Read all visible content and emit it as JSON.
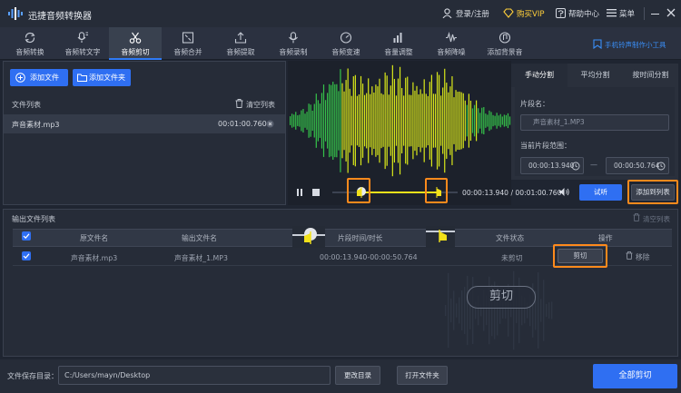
{
  "app": {
    "title": "迅捷音频转换器",
    "login": "登录/注册",
    "vip": "购买VIP",
    "help": "帮助中心",
    "menu": "菜单"
  },
  "nav": {
    "tabs": [
      {
        "label": "音频转换",
        "icon": "refresh-icon"
      },
      {
        "label": "音频转文字",
        "icon": "speech-text-icon"
      },
      {
        "label": "音频剪切",
        "icon": "scissors-icon"
      },
      {
        "label": "音频合并",
        "icon": "merge-icon"
      },
      {
        "label": "音频提取",
        "icon": "extract-icon"
      },
      {
        "label": "音频录制",
        "icon": "microphone-icon"
      },
      {
        "label": "音频变速",
        "icon": "speed-icon"
      },
      {
        "label": "音量调整",
        "icon": "volume-bars-icon"
      },
      {
        "label": "音频降噪",
        "icon": "noise-wave-icon"
      },
      {
        "label": "添加背景音",
        "icon": "music-add-icon"
      }
    ],
    "active_index": 2,
    "ringtone": "手机铃声制作小工具"
  },
  "files": {
    "add_file": "添加文件",
    "add_folder": "添加文件夹",
    "list_label": "文件列表",
    "clear_list": "清空列表",
    "items": [
      {
        "name": "声音素材.mp3",
        "duration": "00:01:00.760"
      }
    ]
  },
  "player": {
    "current_time": "00:00:13.940",
    "separator": "/",
    "total_time": "00:01:00.760",
    "progress": 0.229,
    "range_start": 0.229,
    "range_end": 0.836,
    "listen": "试听",
    "add_to_list": "添加到列表"
  },
  "split": {
    "tabs": [
      "手动分割",
      "平均分割",
      "按时间分割"
    ],
    "active_index": 0,
    "segment_name_label": "片段名：",
    "segment_name_value": "声音素材_1.MP3",
    "range_label": "当前片段范围：",
    "range_start": "00:00:13.940",
    "range_dash": "—",
    "range_end": "00:00:50.764"
  },
  "output": {
    "title": "输出文件列表",
    "clear_list": "清空列表",
    "headers": [
      "原文件名",
      "输出文件名",
      "片段时间/时长",
      "文件状态",
      "操作"
    ],
    "rows": [
      {
        "source": "声音素材.mp3",
        "output": "声音素材_1.MP3",
        "segment": "00:00:13.940-00:00:50.764",
        "status": "未剪切",
        "cut": "剪切",
        "remove": "移除"
      }
    ],
    "zoom_cut_label": "剪切"
  },
  "footer": {
    "save_dir_label": "文件保存目录：",
    "save_dir_value": "C:/Users/mayn/Desktop",
    "change_dir": "更改目录",
    "open_folder": "打开文件夹",
    "cut_all": "全部剪切"
  },
  "colors": {
    "accent": "#2f6ff2",
    "highlight": "#ff8a1c",
    "vip": "#ffcf3a",
    "wave_green": "#35c24a",
    "wave_yellow": "#d9e81a"
  }
}
